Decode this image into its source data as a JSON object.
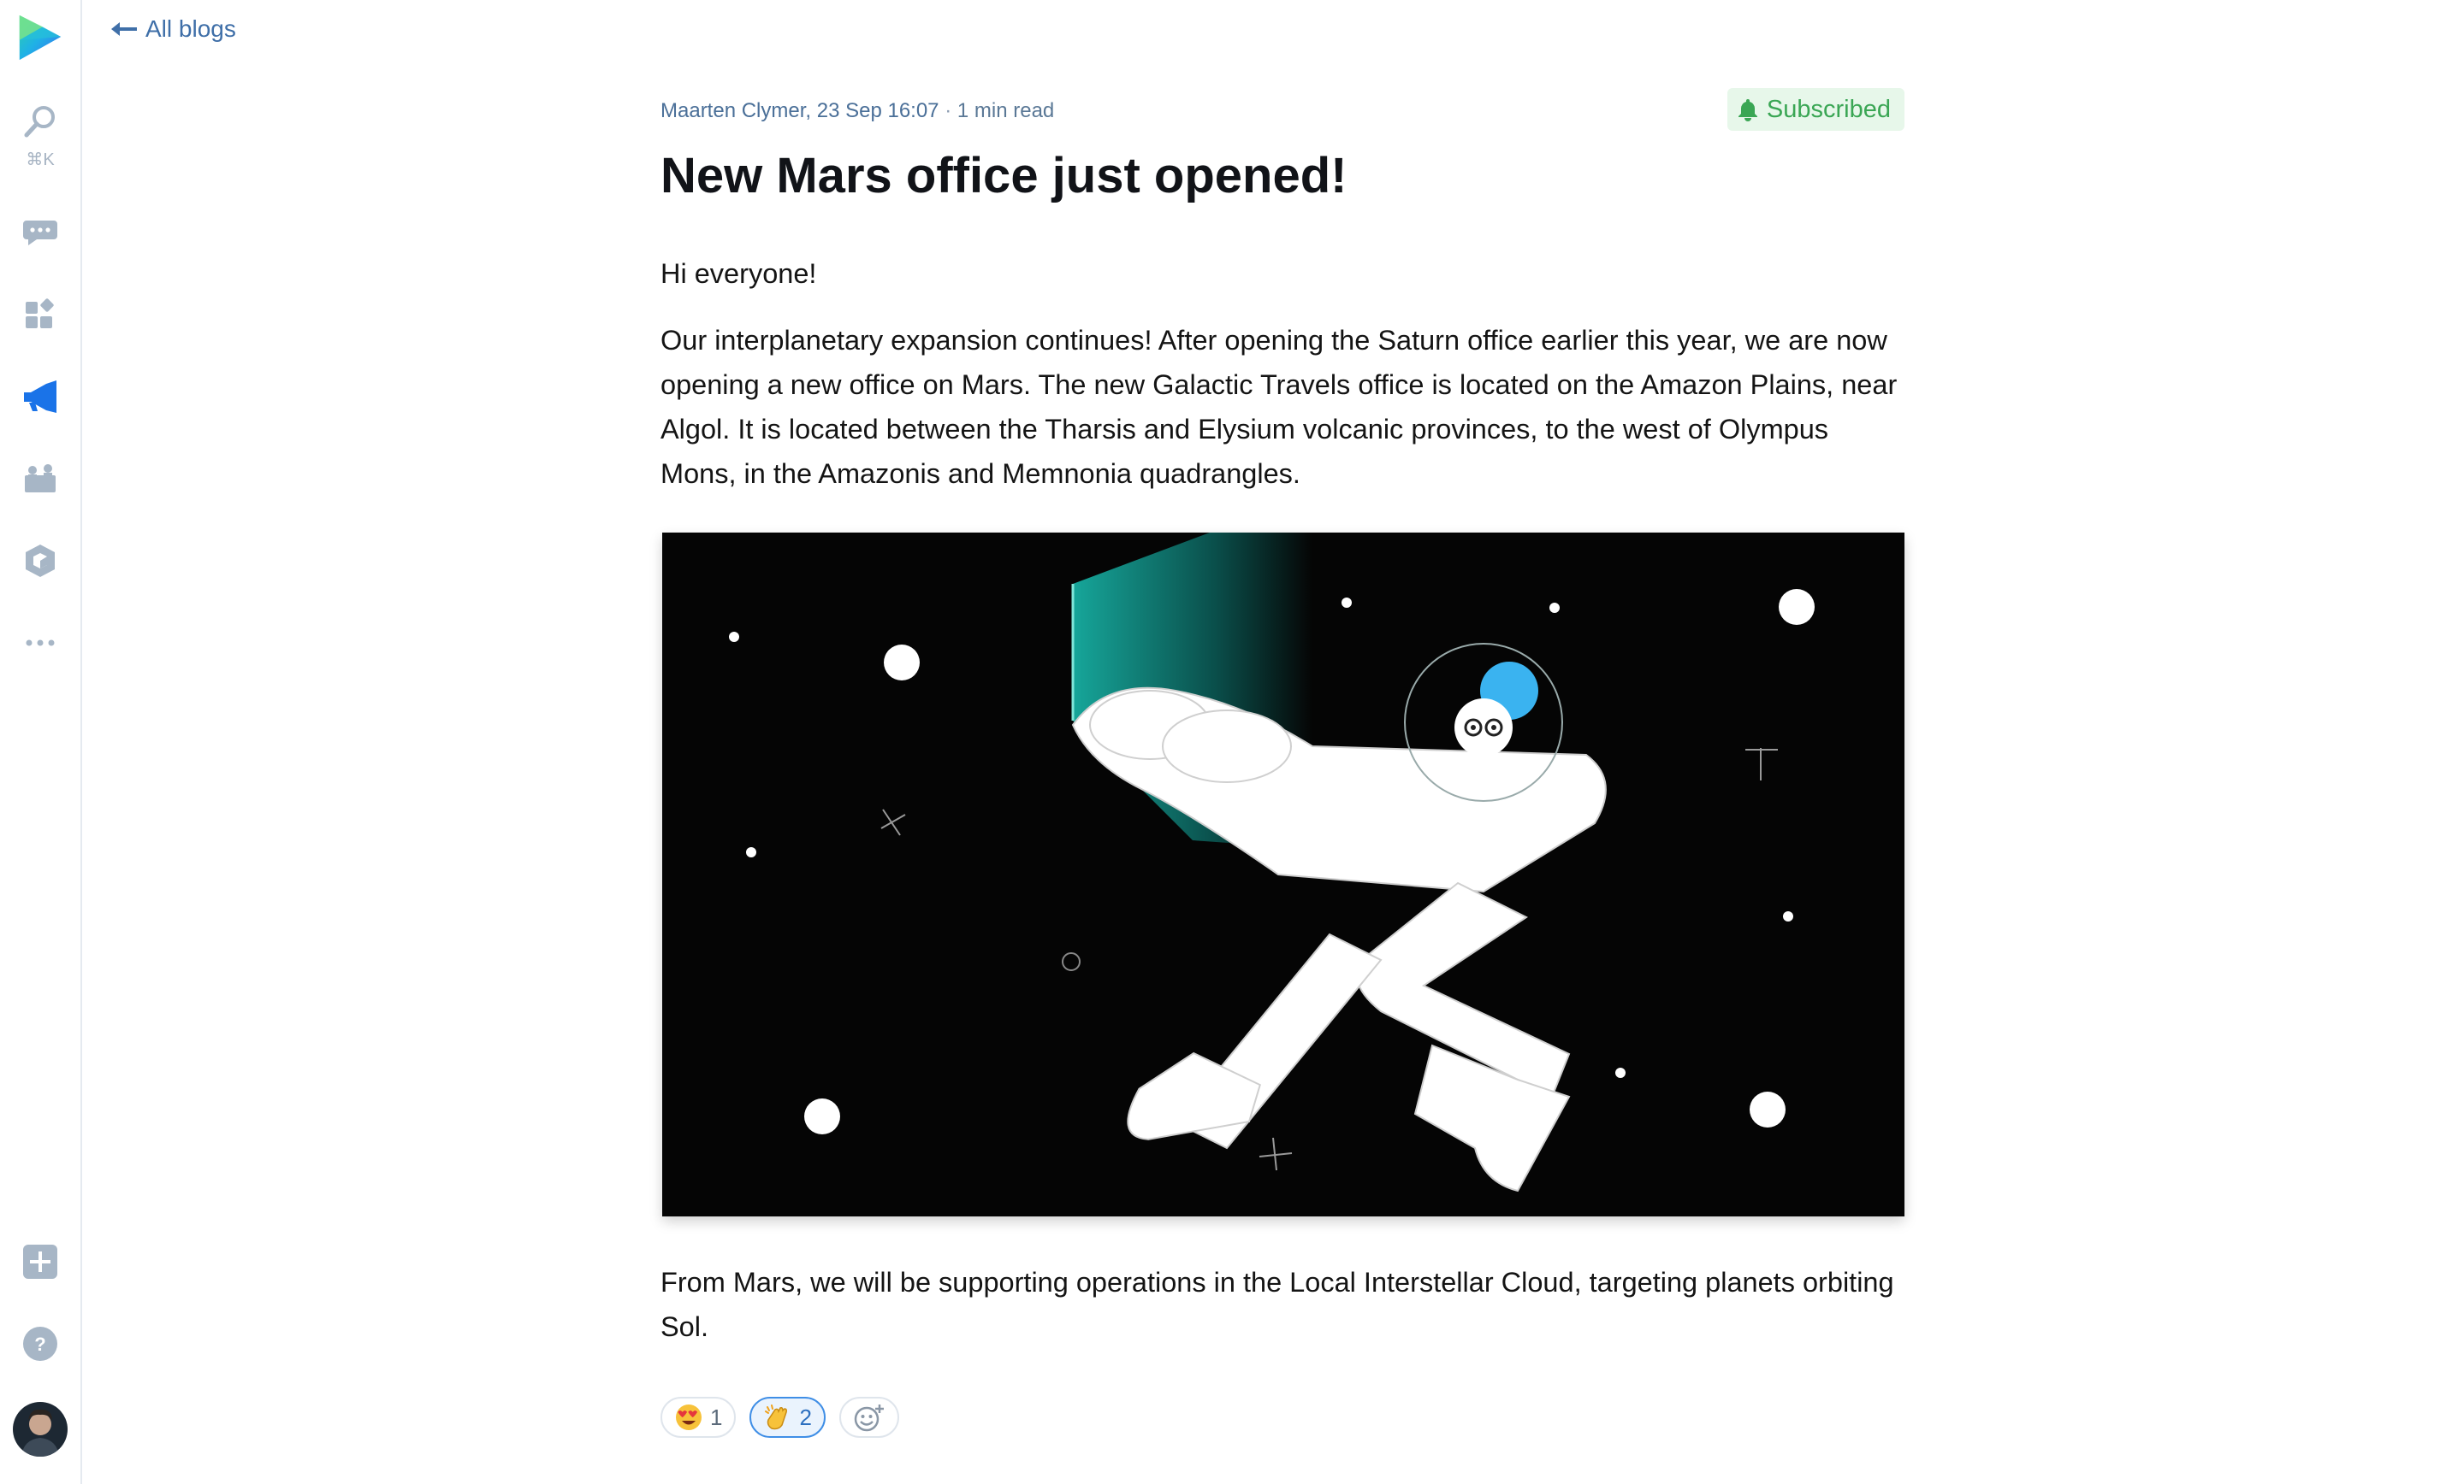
{
  "sidebar": {
    "search_shortcut": "⌘K",
    "items": [
      {
        "name": "logo-icon"
      },
      {
        "name": "search-icon"
      },
      {
        "name": "chat-icon"
      },
      {
        "name": "apps-icon"
      },
      {
        "name": "megaphone-icon"
      },
      {
        "name": "team-icon"
      },
      {
        "name": "cube-icon"
      },
      {
        "name": "more-icon"
      },
      {
        "name": "add-icon"
      },
      {
        "name": "help-icon"
      },
      {
        "name": "avatar"
      }
    ],
    "accent": "#1a73e8"
  },
  "nav": {
    "back_label": "All blogs"
  },
  "post": {
    "author": "Maarten Clymer",
    "date": "23 Sep 16:07",
    "separator": "·",
    "read_time": "1 min read",
    "subscribe_label": "Subscribed",
    "title": "New Mars office just opened!",
    "greeting": "Hi everyone!",
    "body": "Our interplanetary expansion continues! After opening the Saturn office earlier this year, we are now opening a new office on Mars. The new Galactic Travels office is located on the Amazon Plains, near Algol. It is located between the Tharsis and Elysium volcanic provinces, to the west of Olympus Mons, in the Amazonis and Memnonia quadrangles.",
    "closing": "From Mars, we will be supporting operations in the Local Interstellar Cloud, targeting planets orbiting Sol."
  },
  "reactions": [
    {
      "emoji": "heart-eyes-icon",
      "count": "1",
      "active": false
    },
    {
      "emoji": "clap-icon",
      "count": "2",
      "active": true
    },
    {
      "emoji": "add-reaction-icon",
      "count": "",
      "active": false
    }
  ],
  "colors": {
    "link": "#3f6fa8",
    "subscribed_bg": "#e7f7ea",
    "subscribed_fg": "#3aa654",
    "hero_bg": "#050505"
  }
}
